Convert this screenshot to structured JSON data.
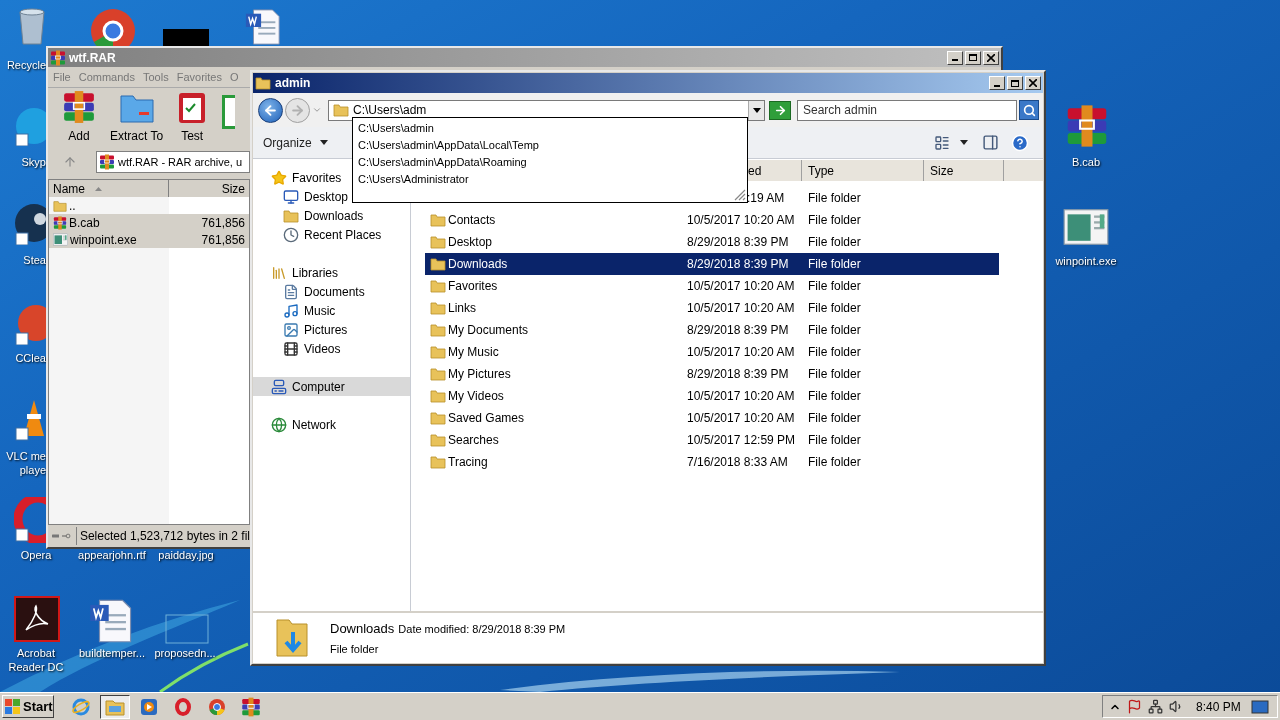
{
  "desktop_icons": [
    {
      "label": [
        "Recycle"
      ]
    },
    {
      "label": [
        "Skyp"
      ]
    },
    {
      "label": [
        "Stea"
      ]
    },
    {
      "label": [
        "CClea"
      ]
    },
    {
      "label": [
        "VLC me",
        "playe"
      ]
    },
    {
      "label": [
        "Opera"
      ]
    },
    {
      "label": [
        "appearjohn.rtf"
      ]
    },
    {
      "label": [
        "paidday.jpg"
      ]
    },
    {
      "label": [
        "Acrobat",
        "Reader DC"
      ]
    },
    {
      "label": [
        "buildtemper..."
      ]
    },
    {
      "label": [
        "proposedn..."
      ]
    },
    {
      "label": [
        "B.cab"
      ]
    },
    {
      "label": [
        "winpoint.exe"
      ]
    }
  ],
  "winrar": {
    "title": "wtf.RAR",
    "menu": [
      "File",
      "Commands",
      "Tools",
      "Favorites",
      "O"
    ],
    "toolbar": [
      "Add",
      "Extract To",
      "Test"
    ],
    "address": "wtf.RAR - RAR archive, u",
    "columns": [
      "Name",
      "Size"
    ],
    "rows": [
      {
        "name": "..",
        "selected": false
      },
      {
        "name": "B.cab",
        "size": "761,856",
        "selected": true
      },
      {
        "name": "winpoint.exe",
        "size": "761,856",
        "selected": true
      }
    ],
    "status": "Selected 1,523,712 bytes in 2 fil"
  },
  "explorer": {
    "title": "admin",
    "address": "C:\\Users\\adm",
    "suggestions": [
      "C:\\Users\\admin",
      "C:\\Users\\admin\\AppData\\Local\\Temp",
      "C:\\Users\\admin\\AppData\\Roaming",
      "C:\\Users\\Administrator"
    ],
    "search": {
      "placeholder": "Search admin"
    },
    "organize": "Organize",
    "nav": [
      {
        "label": "Favorites",
        "selected": false,
        "children": [
          {
            "label": "Desktop",
            "selected": false
          },
          {
            "label": "Downloads",
            "selected": false
          },
          {
            "label": "Recent Places",
            "selected": false
          }
        ]
      },
      {
        "label": "Libraries",
        "selected": false,
        "children": [
          {
            "label": "Documents",
            "selected": false
          },
          {
            "label": "Music",
            "selected": false
          },
          {
            "label": "Pictures",
            "selected": false
          },
          {
            "label": "Videos",
            "selected": false
          }
        ]
      },
      {
        "label": "Computer",
        "selected": true
      },
      {
        "label": "Network",
        "selected": false
      }
    ],
    "columns": [
      {
        "label": "ed",
        "kind": "partial"
      },
      {
        "label": "Type",
        "kind": "full"
      },
      {
        "label": "Size",
        "kind": "full"
      }
    ],
    "rows": [
      {
        "kind": "partial",
        "date": ":19 AM",
        "type": "File folder",
        "selected": false
      },
      {
        "kind": "full",
        "name": "Contacts",
        "date": "10/5/2017 10:20 AM",
        "type": "File folder",
        "selected": false
      },
      {
        "kind": "full",
        "name": "Desktop",
        "date": "8/29/2018 8:39 PM",
        "type": "File folder",
        "selected": false
      },
      {
        "kind": "full",
        "name": "Downloads",
        "date": "8/29/2018 8:39 PM",
        "type": "File folder",
        "selected": true
      },
      {
        "kind": "full",
        "name": "Favorites",
        "date": "10/5/2017 10:20 AM",
        "type": "File folder",
        "selected": false
      },
      {
        "kind": "full",
        "name": "Links",
        "date": "10/5/2017 10:20 AM",
        "type": "File folder",
        "selected": false
      },
      {
        "kind": "full",
        "name": "My Documents",
        "date": "8/29/2018 8:39 PM",
        "type": "File folder",
        "selected": false
      },
      {
        "kind": "full",
        "name": "My Music",
        "date": "10/5/2017 10:20 AM",
        "type": "File folder",
        "selected": false
      },
      {
        "kind": "full",
        "name": "My Pictures",
        "date": "8/29/2018 8:39 PM",
        "type": "File folder",
        "selected": false
      },
      {
        "kind": "full",
        "name": "My Videos",
        "date": "10/5/2017 10:20 AM",
        "type": "File folder",
        "selected": false
      },
      {
        "kind": "full",
        "name": "Saved Games",
        "date": "10/5/2017 10:20 AM",
        "type": "File folder",
        "selected": false
      },
      {
        "kind": "full",
        "name": "Searches",
        "date": "10/5/2017 12:59 PM",
        "type": "File folder",
        "selected": false
      },
      {
        "kind": "full",
        "name": "Tracing",
        "date": "7/16/2018 8:33 AM",
        "type": "File folder",
        "selected": false
      }
    ],
    "details": {
      "name": "Downloads",
      "meta": "Date modified: 8/29/2018 8:39 PM",
      "type": "File folder"
    }
  },
  "taskbar": {
    "start": "Start",
    "apps": [
      {
        "selected": false
      },
      {
        "selected": true
      },
      {
        "selected": false
      },
      {
        "selected": false
      },
      {
        "selected": false
      },
      {
        "selected": false
      }
    ],
    "clock": "8:40 PM"
  }
}
